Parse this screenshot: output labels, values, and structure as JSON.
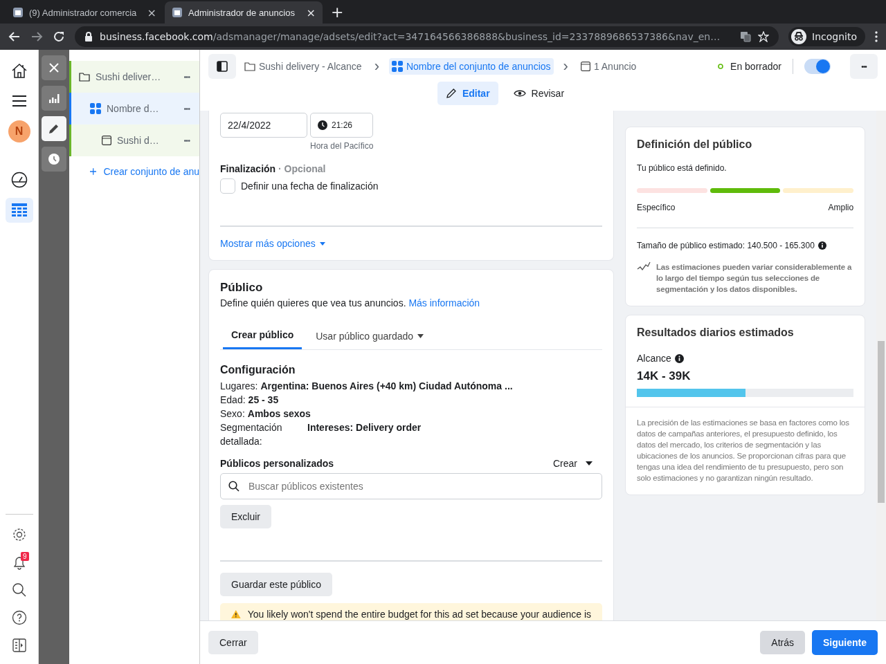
{
  "browser": {
    "tabs": [
      {
        "title": "(9) Administrador comercia",
        "selected": false
      },
      {
        "title": "Administrador de anuncios",
        "selected": true
      }
    ],
    "close_glyph": "×",
    "new_tab": "+",
    "url_host": "business.facebook.com",
    "url_path": "/adsmanager/manage/adsets/edit?act=347164566386888&business_id=2337889686537386&nav_en…",
    "profile": "Incognito"
  },
  "left_rail": {
    "avatar_letter": "N",
    "items": [
      {
        "kind": "home",
        "selected": false
      },
      {
        "kind": "menu",
        "selected": false
      },
      {
        "kind": "avatar",
        "selected": false
      },
      {
        "kind": "gauge",
        "selected": false
      },
      {
        "kind": "table",
        "selected": true
      }
    ],
    "bottom": [
      {
        "kind": "settings"
      },
      {
        "kind": "bell",
        "badge": "9"
      },
      {
        "kind": "search"
      },
      {
        "kind": "help"
      },
      {
        "kind": "panel"
      }
    ]
  },
  "tool_rail": [
    {
      "kind": "close",
      "selected": false
    },
    {
      "kind": "chart",
      "selected": false
    },
    {
      "kind": "edit",
      "selected": true
    },
    {
      "kind": "history",
      "selected": false
    }
  ],
  "tree": {
    "items": [
      {
        "kind": "campaign",
        "label": "Sushi deliver…",
        "selected": false
      },
      {
        "kind": "adset",
        "label": "Nombre d…",
        "selected": true
      },
      {
        "kind": "ad",
        "label": "Sushi d…",
        "selected": false
      }
    ],
    "more": "•••",
    "create": "Crear conjunto de anu"
  },
  "topbar": {
    "breadcrumbs": [
      {
        "kind": "campaign",
        "label": "Sushi delivery - Alcance",
        "selected": false
      },
      {
        "kind": "adset",
        "label": "Nombre del conjunto de anuncios",
        "selected": true
      },
      {
        "kind": "ad",
        "label": "1 Anuncio",
        "selected": false
      }
    ],
    "separator": "›",
    "more": "•••",
    "status": "En borrador",
    "toggle_on": true,
    "modes": [
      {
        "kind": "edit",
        "label": "Editar",
        "selected": true
      },
      {
        "kind": "review",
        "label": "Revisar",
        "selected": false
      }
    ]
  },
  "schedule": {
    "start_date": "22/4/2022",
    "start_time": "21:26",
    "timezone": "Hora del Pacífico",
    "end_label": "Finalización",
    "end_optional": "· Opcional",
    "end_checkbox": {
      "label": "Definir una fecha de finalización",
      "checked": false
    },
    "more_options": "Mostrar más opciones"
  },
  "audience": {
    "title": "Público",
    "description": "Define quién quieres que vea tus anuncios.",
    "link": "Más información",
    "tabs": [
      {
        "label": "Crear público",
        "selected": true,
        "dropdown": false
      },
      {
        "label": "Usar público guardado",
        "selected": false,
        "dropdown": true
      }
    ],
    "config_title": "Configuración",
    "config": [
      {
        "label": "Lugares:",
        "value": "Argentina: Buenos Aires (+40 km) Ciudad Autónoma ..."
      },
      {
        "label": "Edad:",
        "value": "25 - 35"
      },
      {
        "label": "Sexo:",
        "value": "Ambos sexos"
      },
      {
        "label": "Segmentación detallada:",
        "value": "Intereses: Delivery order",
        "kind": "column"
      }
    ],
    "custom_title": "Públicos personalizados",
    "create": "Crear",
    "search_placeholder": "Buscar públicos existentes",
    "exclude": "Excluir",
    "save": "Guardar este público",
    "warning": "You likely won't spend the entire budget for this ad set because your audience is"
  },
  "definition": {
    "title": "Definición del público",
    "status": "Tu público está definido.",
    "segments": [
      {
        "color": "#fde2e1"
      },
      {
        "color": "#5fbb0a"
      },
      {
        "color": "#fff0cc"
      }
    ],
    "low": "Específico",
    "high": "Amplio",
    "size": "Tamaño de público estimado: 140.500 - 165.300",
    "note": "Las estimaciones pueden variar considerablemente a lo largo del tiempo según tus selecciones de segmentación y los datos disponibles."
  },
  "results": {
    "title": "Resultados diarios estimados",
    "metric": "Alcance",
    "range": "14K - 39K",
    "level": 0.5,
    "disclaimer": "La precisión de las estimaciones se basa en factores como los datos de campañas anteriores, el presupuesto definido, los datos del mercado, los criterios de segmentación y las ubicaciones de los anuncios. Se proporcionan cifras para que tengas una idea del rendimiento de tu presupuesto, pero son solo estimaciones y no garantizan ningún resultado."
  },
  "footer": {
    "close": "Cerrar",
    "back": "Atrás",
    "next": "Siguiente"
  }
}
